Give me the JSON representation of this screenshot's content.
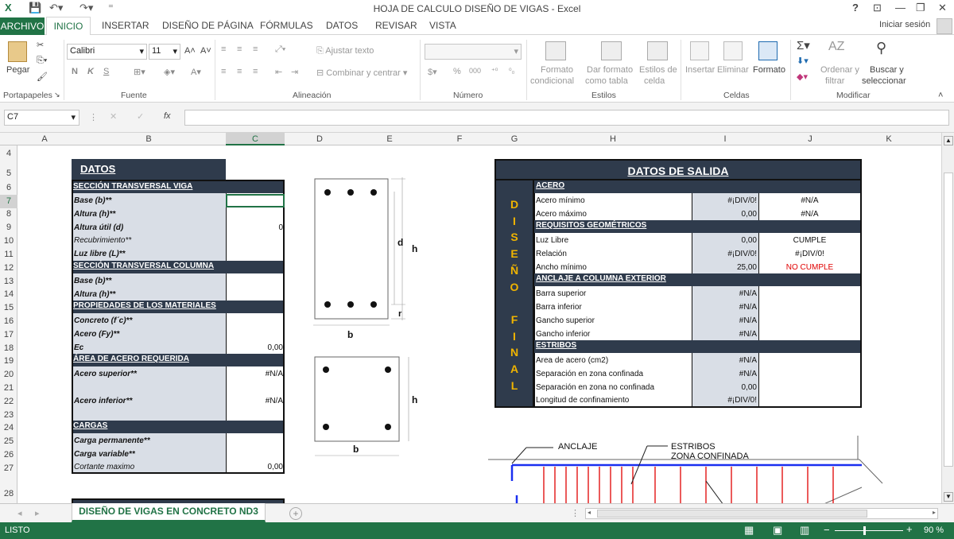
{
  "window": {
    "title": "HOJA DE CALCULO DISEÑO DE VIGAS - Excel",
    "help": "?",
    "controls": [
      "⊡",
      "—",
      "❐",
      "✕"
    ]
  },
  "ribbon_tabs": {
    "archivo": "ARCHIVO",
    "inicio": "INICIO",
    "insertar": "INSERTAR",
    "diseno": "DISEÑO DE PÁGINA",
    "formulas": "FÓRMULAS",
    "datos": "DATOS",
    "revisar": "REVISAR",
    "vista": "VISTA",
    "signin": "Iniciar sesión"
  },
  "ribbon": {
    "pegar": "Pegar",
    "portapapeles": "Portapapeles",
    "font_name": "Calibri",
    "font_size": "11",
    "fuente": "Fuente",
    "bold": "N",
    "italic": "K",
    "underline": "S",
    "ajustar": "Ajustar texto",
    "combinar": "Combinar y centrar",
    "alineacion": "Alineación",
    "numero": "Número",
    "pct": "%",
    "thousands": "000",
    "formato_cond": [
      "Formato",
      "condicional"
    ],
    "dar_formato": [
      "Dar formato",
      "como tabla"
    ],
    "estilos_celda": [
      "Estilos de",
      "celda"
    ],
    "estilos": "Estilos",
    "insertar": "Insertar",
    "eliminar": "Eliminar",
    "formato": "Formato",
    "celdas": "Celdas",
    "ordenar": [
      "Ordenar y",
      "filtrar"
    ],
    "buscar": [
      "Buscar y",
      "seleccionar"
    ],
    "modificar": "Modificar"
  },
  "formula_bar": {
    "name_box": "C7",
    "fx": "fx",
    "value": ""
  },
  "columns": [
    "A",
    "B",
    "C",
    "D",
    "E",
    "F",
    "G",
    "H",
    "I",
    "J",
    "K"
  ],
  "rows": [
    "4",
    "5",
    "6",
    "7",
    "8",
    "9",
    "10",
    "11",
    "12",
    "13",
    "14",
    "15",
    "16",
    "17",
    "18",
    "19",
    "20",
    "21",
    "22",
    "23",
    "24",
    "25",
    "26",
    "27",
    "28"
  ],
  "datos": {
    "title": "DATOS",
    "sec_viga": "SECCIÓN TRANSVERSAL VIGA",
    "base": "Base (b)**",
    "altura": "Altura (h)**",
    "altura_util": "Altura útil (d)",
    "altura_util_val": "0",
    "recubrimiento": "Recubrimiento**",
    "luz": "Luz libre (L)**",
    "sec_col": "SECCIÓN TRANSVERSAL COLUMNA",
    "col_base": "Base (b)**",
    "col_altura": "Altura (h)**",
    "prop": "PROPIEDADES DE LOS MATERIALES",
    "concreto": "Concreto (f´c)**",
    "acero": "Acero (Fy)**",
    "ec": "Ec",
    "ec_val": "0,00",
    "area_req": "ÁREA DE ACERO REQUERIDA",
    "acero_sup": "Acero superior**",
    "acero_sup_val": "#N/A",
    "acero_inf": "Acero inferior**",
    "acero_inf_val": "#N/A",
    "cargas": "CARGAS",
    "carga_perm": "Carga permanente**",
    "carga_var": "Carga variable**",
    "cortante": "Cortante maximo",
    "cortante_val": "0,00"
  },
  "diagram": {
    "d": "d",
    "h": "h",
    "r": "r",
    "b": "b",
    "h2": "h",
    "b2": "b"
  },
  "salida": {
    "title": "DATOS DE SALIDA",
    "side_letters": [
      "D",
      "I",
      "S",
      "E",
      "Ñ",
      "O",
      "",
      "F",
      "I",
      "N",
      "A",
      "L"
    ],
    "acero_hdr": "ACERO",
    "acero_min": "Acero mínimo",
    "acero_min_i": "#¡DIV/0!",
    "acero_min_j": "#N/A",
    "acero_max": "Acero máximo",
    "acero_max_i": "0,00",
    "acero_max_j": "#N/A",
    "req_hdr": "REQUISITOS GEOMÉTRICOS",
    "luz": "Luz Libre",
    "luz_i": "0,00",
    "luz_j": "CUMPLE",
    "rel": "Relación",
    "rel_i": "#¡DIV/0!",
    "rel_j": "#¡DIV/0!",
    "ancho": "Ancho mínimo",
    "ancho_i": "25,00",
    "ancho_j": "NO CUMPLE",
    "anclaje_hdr": "ANCLAJE A COLUMNA EXTERIOR",
    "barra_sup": "Barra superior",
    "barra_sup_i": "#N/A",
    "barra_inf": "Barra inferior",
    "barra_inf_i": "#N/A",
    "gancho_sup": "Gancho superior",
    "gancho_sup_i": "#N/A",
    "gancho_inf": "Gancho inferior",
    "gancho_inf_i": "#N/A",
    "estribos_hdr": "ESTRIBOS",
    "area": "Area de acero (cm2)",
    "area_i": "#N/A",
    "sep_conf": "Separación en zona confinada",
    "sep_conf_i": "#N/A",
    "sep_noconf": "Separación en zona no confinada",
    "sep_noconf_i": "0,00",
    "long": "Longitud de confinamiento",
    "long_i": "#¡DIV/0!"
  },
  "drawing": {
    "anclaje": "ANCLAJE",
    "estribos": "ESTRIBOS",
    "zona": "ZONA CONFINADA"
  },
  "sheet_tab": "DISEÑO DE VIGAS EN CONCRETO ND3",
  "status": {
    "mode": "LISTO",
    "zoom": "90 %"
  },
  "colors": {
    "excel_green": "#217346",
    "navy": "#2f3b4c",
    "gold": "#f0b400",
    "label_bg": "#d9dee6",
    "red_text": "#e00000"
  }
}
